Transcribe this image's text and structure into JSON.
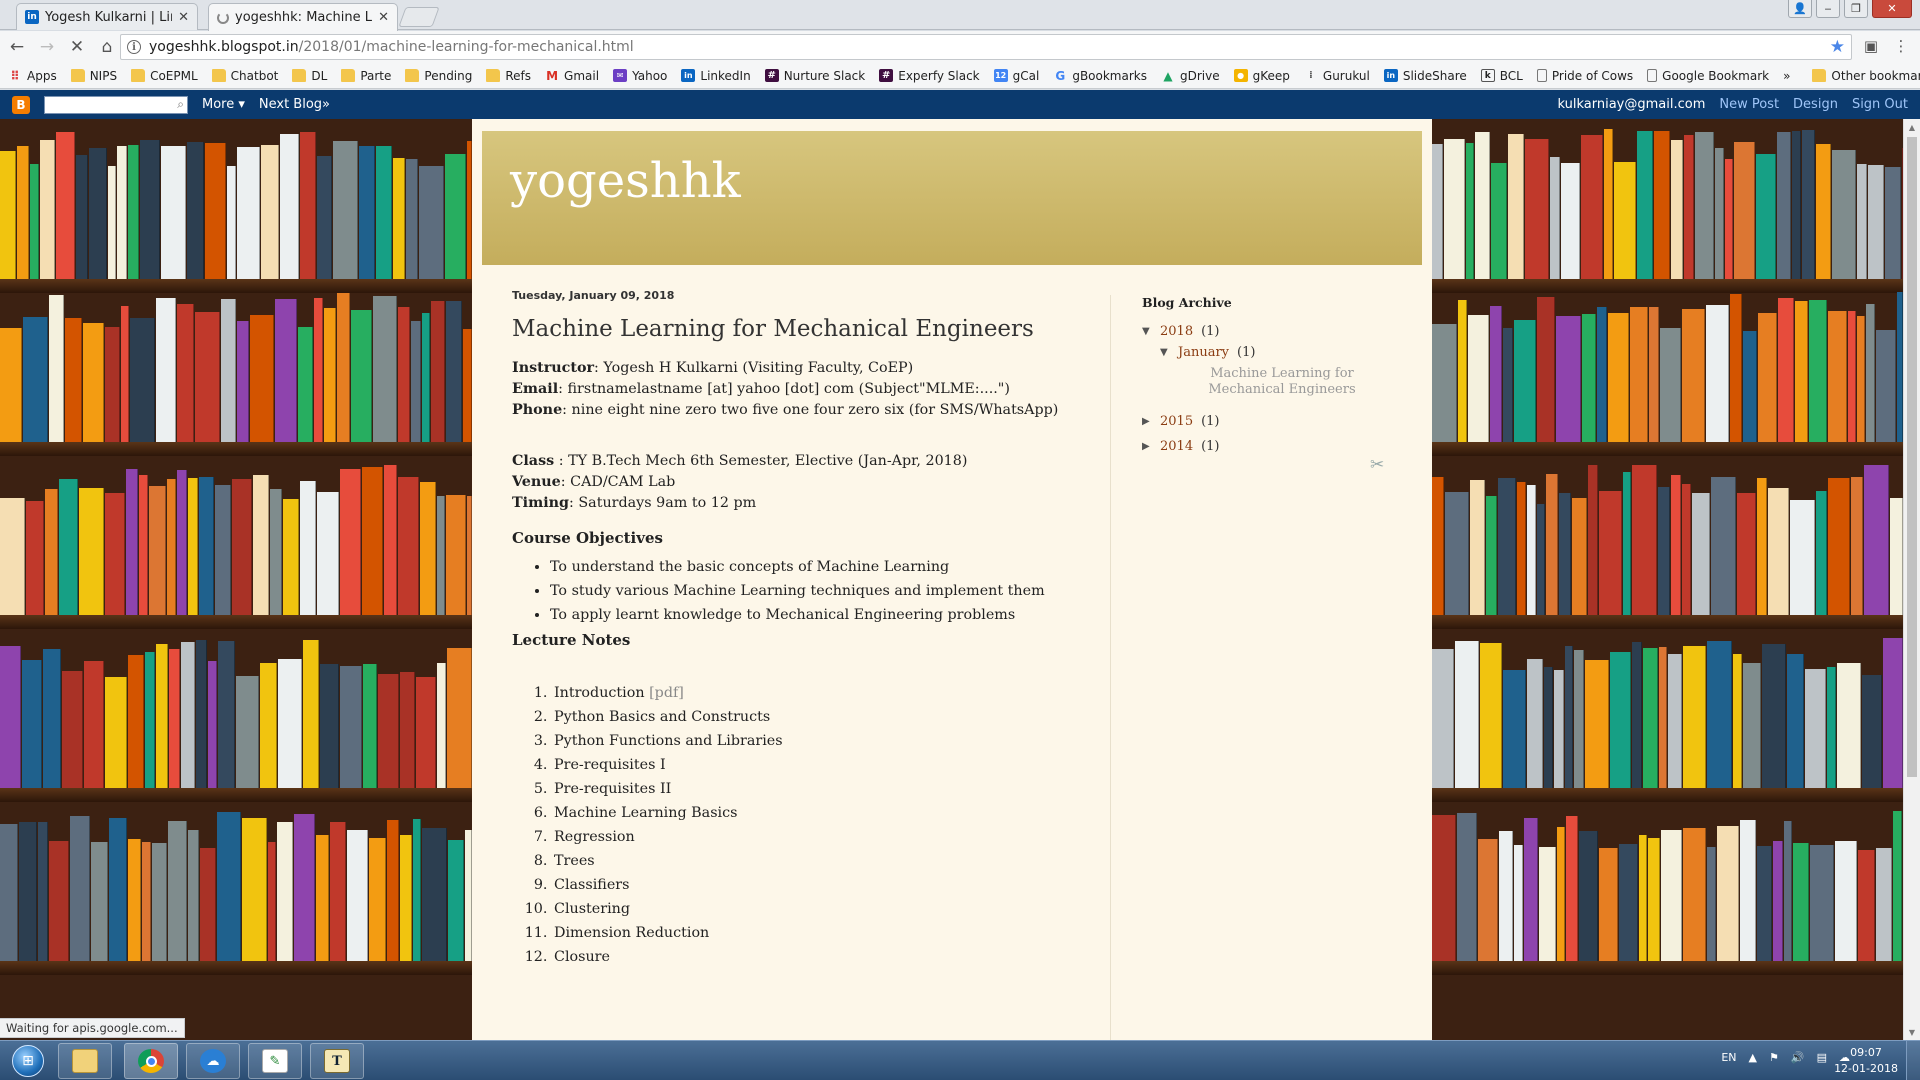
{
  "browser": {
    "tabs": [
      {
        "title": "Yogesh Kulkarni | LinkedIn",
        "favicon": "linkedin-icon",
        "active": false
      },
      {
        "title": "yogeshhk: Machine Learning for Mechanical Engineers",
        "favicon": "loading-icon",
        "active": true
      }
    ],
    "url_host": "yogeshhk.blogspot.in",
    "url_path": "/2018/01/machine-learning-for-mechanical.html",
    "bookmarks": [
      {
        "label": "Apps",
        "icon": "apps-grid-icon"
      },
      {
        "label": "NIPS",
        "icon": "folder-icon"
      },
      {
        "label": "CoEPML",
        "icon": "folder-icon"
      },
      {
        "label": "Chatbot",
        "icon": "folder-icon"
      },
      {
        "label": "DL",
        "icon": "folder-icon"
      },
      {
        "label": "Parte",
        "icon": "folder-icon"
      },
      {
        "label": "Pending",
        "icon": "folder-icon"
      },
      {
        "label": "Refs",
        "icon": "folder-icon"
      },
      {
        "label": "Gmail",
        "icon": "gmail-icon"
      },
      {
        "label": "Yahoo",
        "icon": "yahoo-icon"
      },
      {
        "label": "LinkedIn",
        "icon": "linkedin-icon"
      },
      {
        "label": "Nurture Slack",
        "icon": "slack-icon"
      },
      {
        "label": "Experfy Slack",
        "icon": "slack-icon"
      },
      {
        "label": "gCal",
        "icon": "calendar-icon"
      },
      {
        "label": "gBookmarks",
        "icon": "google-icon"
      },
      {
        "label": "gDrive",
        "icon": "drive-icon"
      },
      {
        "label": "gKeep",
        "icon": "keep-icon"
      },
      {
        "label": "Gurukul",
        "icon": "gurukul-icon"
      },
      {
        "label": "SlideShare",
        "icon": "linkedin-icon"
      },
      {
        "label": "BCL",
        "icon": "bcl-icon"
      },
      {
        "label": "Pride of Cows",
        "icon": "page-icon"
      },
      {
        "label": "Google Bookmark",
        "icon": "page-icon"
      }
    ],
    "bookmarks_more": "»",
    "other_bookmarks": "Other bookmarks",
    "status_text": "Waiting for apis.google.com..."
  },
  "blogger_bar": {
    "more": "More ▾",
    "next_blog": "Next Blog»",
    "email": "kulkarniay@gmail.com",
    "new_post": "New Post",
    "design": "Design",
    "sign_out": "Sign Out"
  },
  "blog": {
    "title": "yogeshhk",
    "post_date": "Tuesday, January 09, 2018",
    "post_title": "Machine Learning for Mechanical Engineers",
    "instructor_label": "Instructor",
    "instructor_value": ": Yogesh H Kulkarni (Visiting Faculty, CoEP)",
    "email_label": "Email",
    "email_value": ": firstnamelastname [at] yahoo [dot] com (Subject\"MLME:....\")",
    "phone_label": "Phone",
    "phone_value": ": nine eight nine zero two five one four zero six (for SMS/WhatsApp)",
    "class_label": "Class",
    "class_value": " : TY B.Tech Mech 6th Semester, Elective (Jan-Apr, 2018)",
    "venue_label": "Venue",
    "venue_value": ": CAD/CAM Lab",
    "timing_label": "Timing",
    "timing_value": ": Saturdays 9am to 12 pm",
    "objectives_heading": "Course Objectives",
    "objectives": [
      "To understand the basic concepts of Machine Learning",
      "To study various Machine Learning techniques and implement them",
      "To apply learnt knowledge to Mechanical Engineering problems"
    ],
    "lecture_heading": "Lecture Notes",
    "lectures": [
      {
        "text": "Introduction ",
        "link": "[pdf]"
      },
      {
        "text": "Python Basics and Constructs"
      },
      {
        "text": "Python Functions and Libraries"
      },
      {
        "text": "Pre-requisites I"
      },
      {
        "text": "Pre-requisites II"
      },
      {
        "text": "Machine Learning Basics"
      },
      {
        "text": "Regression"
      },
      {
        "text": "Trees"
      },
      {
        "text": "Classifiers"
      },
      {
        "text": "Clustering"
      },
      {
        "text": "Dimension Reduction"
      },
      {
        "text": "Closure"
      }
    ]
  },
  "sidebar": {
    "heading": "Blog Archive",
    "years": [
      {
        "year": "2018",
        "count": "(1)",
        "expanded": true
      },
      {
        "year": "2015",
        "count": "(1)",
        "expanded": false
      },
      {
        "year": "2014",
        "count": "(1)",
        "expanded": false
      }
    ],
    "month": "January",
    "month_count": "(1)",
    "post_link": "Machine Learning for Mechanical Engineers"
  },
  "taskbar": {
    "language": "EN",
    "time": "09:07",
    "date": "12-01-2018",
    "apps": [
      "windows-explorer-icon",
      "chrome-icon",
      "cloud-sync-icon",
      "notepad-icon",
      "texstudio-icon"
    ]
  },
  "colors": {
    "blogger_bar": "#0b3a6e",
    "header_gold": "#c4ad5c",
    "post_bg": "#fdf7e9",
    "archive_link": "#8b3d13"
  }
}
